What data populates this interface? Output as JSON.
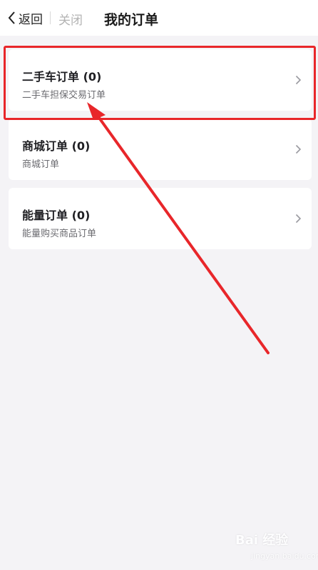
{
  "nav": {
    "back_label": "返回",
    "close_label": "关闭",
    "title": "我的订单"
  },
  "orders": [
    {
      "title": "二手车订单 (0)",
      "subtitle": "二手车担保交易订单"
    },
    {
      "title": "商城订单 (0)",
      "subtitle": "商城订单"
    },
    {
      "title": "能量订单 (0)",
      "subtitle": "能量购买商品订单"
    }
  ],
  "annotation": {
    "color": "#e8262a"
  },
  "watermark": {
    "main": "Bai 经验",
    "sub": "jingyan.baidu.com"
  },
  "colors": {
    "background": "#f4f3f6",
    "card": "#ffffff",
    "muted": "#b3b3b3"
  }
}
